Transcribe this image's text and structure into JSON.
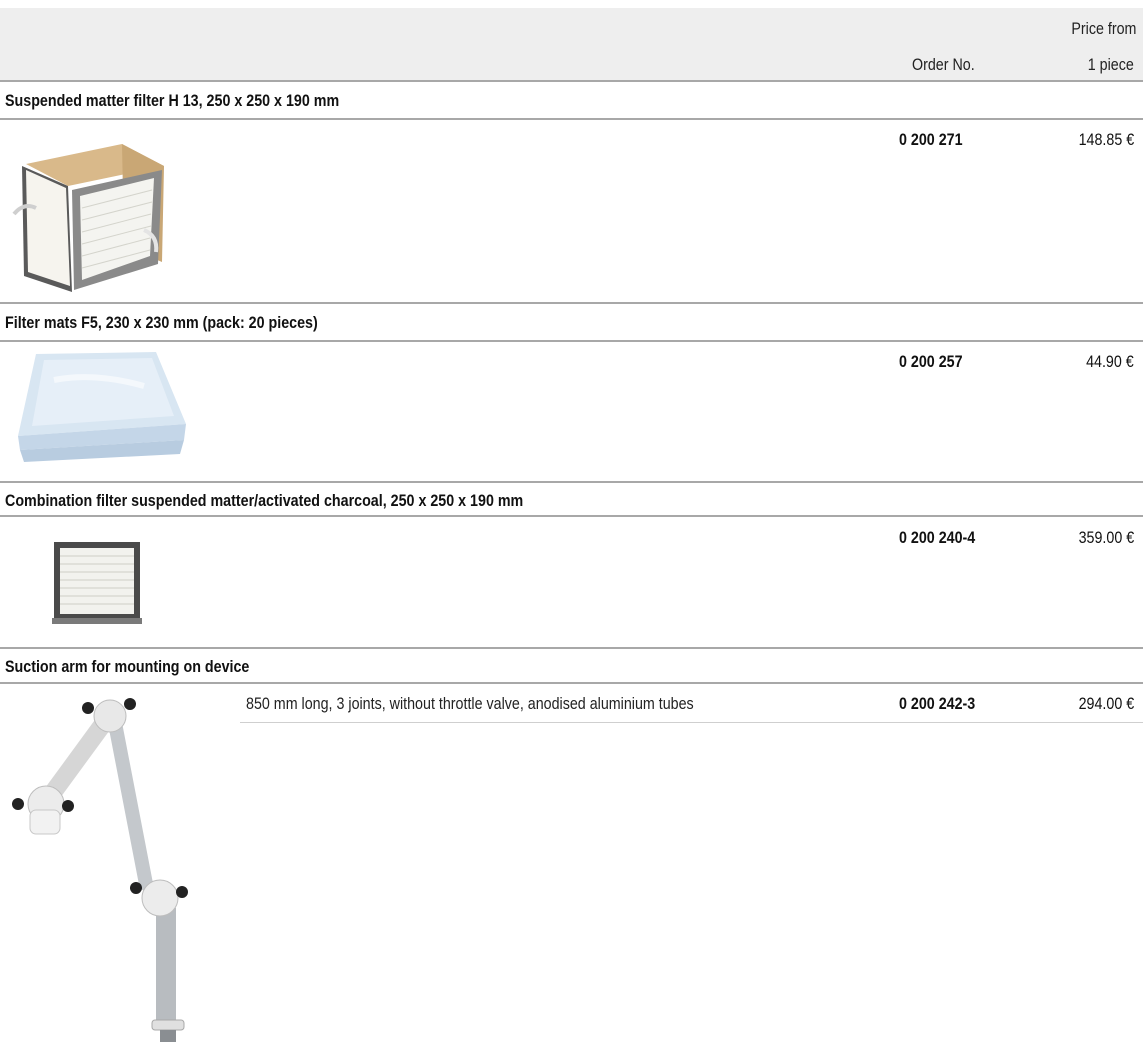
{
  "header": {
    "order_no": "Order No.",
    "price_line1": "Price from",
    "price_line2": "1 piece"
  },
  "products": [
    {
      "title": "Suspended matter filter H 13, 250 x 250 x 190 mm",
      "order_no": "0 200 271",
      "price": "148.85 €",
      "image": "hepa-filter-box-image"
    },
    {
      "title": "Filter mats F5, 230 x 230 mm (pack: 20 pieces)",
      "order_no": "0 200 257",
      "price": "44.90 €",
      "image": "filter-mat-stack-image"
    },
    {
      "title": "Combination filter suspended matter/activated charcoal, 250 x 250 x 190 mm",
      "order_no": "0 200 240-4",
      "price": "359.00 €",
      "image": "combination-filter-image"
    },
    {
      "title": "Suction arm for mounting on device",
      "description": "850 mm long, 3 joints, without throttle valve, anodised aluminium tubes",
      "order_no": "0 200 242-3",
      "price": "294.00 €",
      "image": "suction-arm-image"
    }
  ]
}
